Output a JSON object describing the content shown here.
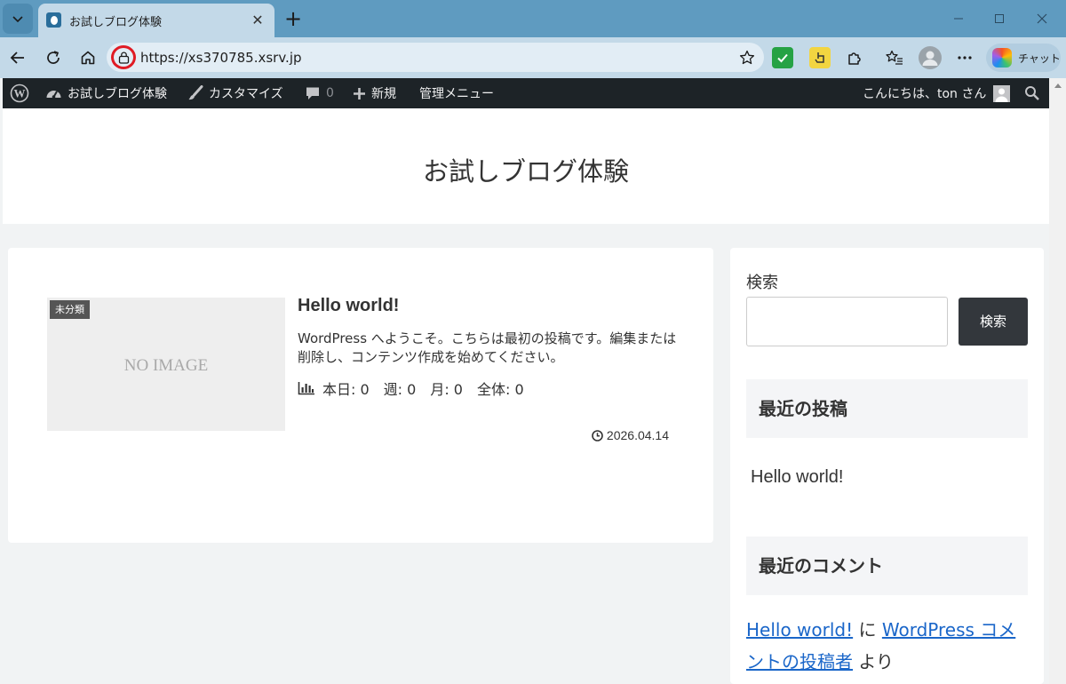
{
  "browser": {
    "tab_title": "お試しブログ体験",
    "url": "https://xs370785.xsrv.jp",
    "chat_label": "チャット"
  },
  "adminbar": {
    "site_name": "お試しブログ体験",
    "customize": "カスタマイズ",
    "comments_count": "0",
    "new": "新規",
    "admin_menu": "管理メニュー",
    "greeting": "こんにちは、ton さん"
  },
  "site": {
    "title": "お試しブログ体験"
  },
  "post": {
    "category": "未分類",
    "thumbnail_placeholder": "NO IMAGE",
    "title": "Hello world!",
    "excerpt": "WordPress へようこそ。こちらは最初の投稿です。編集または削除し、コンテンツ作成を始めてください。",
    "pageviews": "本日: 0　週: 0　月: 0　全体: 0",
    "date": "2026.04.14"
  },
  "sidebar": {
    "search_label": "検索",
    "search_placeholder": "",
    "search_button": "検索",
    "recent_posts_heading": "最近の投稿",
    "recent_posts": [
      "Hello world!"
    ],
    "recent_comments_heading": "最近のコメント",
    "comment": {
      "post_link": "Hello world!",
      "connector": "に",
      "author_link_part1": "WordPress コメ",
      "author_link_part2": "ントの投稿者",
      "suffix": "より"
    }
  }
}
